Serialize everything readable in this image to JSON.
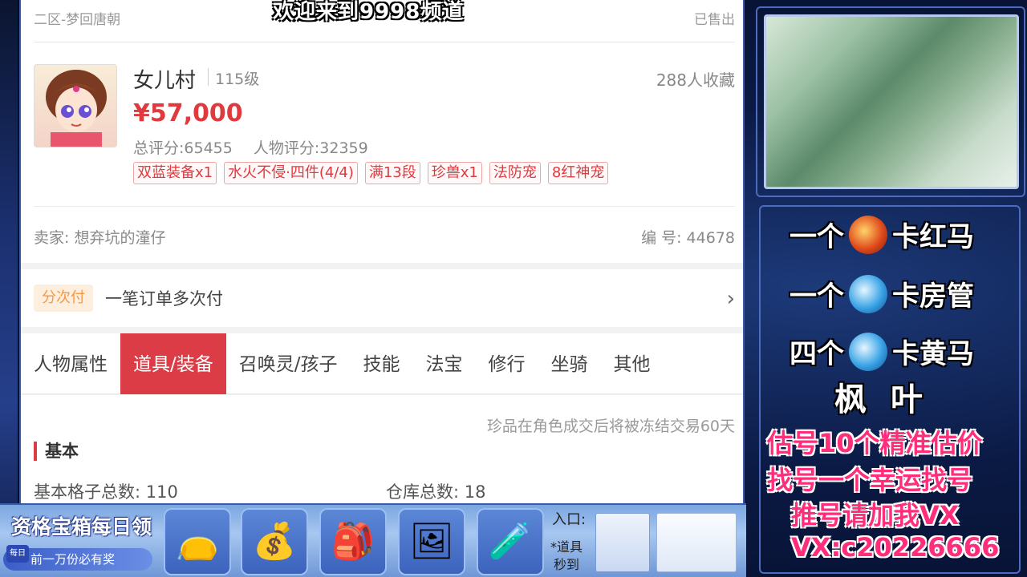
{
  "stream": {
    "banner": "欢迎来到9998频道"
  },
  "listing": {
    "server_line": "二区-梦回唐朝",
    "status": "已售出",
    "role_name": "女儿村",
    "level": "115级",
    "favorites": "288人收藏",
    "price": "¥57,000",
    "total_score": "总评分:65455",
    "role_score": "人物评分:32359",
    "tags": [
      "双蓝装备x1",
      "水火不侵·四件(4/4)",
      "满13段",
      "珍兽x1",
      "法防宠",
      "8红神宠"
    ],
    "seller": "卖家: 想弃坑的潼仔",
    "serial": "编 号: 44678"
  },
  "payment": {
    "badge": "分次付",
    "text": "一笔订单多次付",
    "chevron": "›"
  },
  "tabs": {
    "items": [
      "人物属性",
      "道具/装备",
      "召唤灵/孩子",
      "技能",
      "法宝",
      "修行",
      "坐骑",
      "其他"
    ],
    "active_index": 1
  },
  "content": {
    "notice": "珍品在角色成交后将被冻结交易60天",
    "section_title": "基本",
    "bag_slots_label": "基本格子总数:",
    "bag_slots_value": "110",
    "warehouse_label": "仓库总数:",
    "warehouse_value": "18"
  },
  "promo": {
    "title": "资格宝箱每日领",
    "daily": "每日",
    "subtitle": "前一万份必有奖",
    "entry": "入口:",
    "entry_note": "*道具\n秒到",
    "slot_icons": [
      "bag-icon",
      "treasure-bowl-icon",
      "money-bag-icon",
      "gold-frame-icon",
      "potion-icon"
    ]
  },
  "right_panel": {
    "lines": [
      {
        "prefix": "一个",
        "suffix": "卡红马",
        "orb": "red"
      },
      {
        "prefix": "一个",
        "suffix": "卡房管",
        "orb": "blue"
      },
      {
        "prefix": "四个",
        "suffix": "卡黄马",
        "orb": "blue"
      }
    ],
    "streamer_name": "枫叶",
    "ad_1": "估号10个精准估价",
    "ad_2": "找号一个幸运找号",
    "ad_3": "推号请加我VX",
    "ad_4": "VX:c20226666"
  },
  "colors": {
    "accent_red": "#dc3c46",
    "price_red": "#e0393e",
    "pink_text": "#ff2d7a",
    "payment_badge": "#f29a48"
  }
}
